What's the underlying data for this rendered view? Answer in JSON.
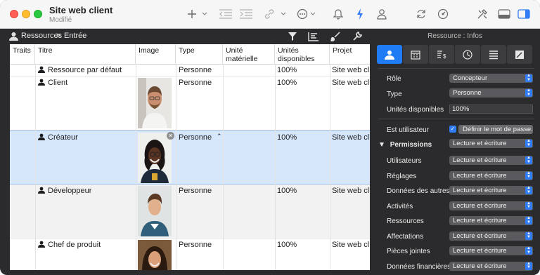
{
  "window": {
    "title": "Site web client",
    "subtitle": "Modifié"
  },
  "toolbar": {
    "icons": [
      "plus-icon",
      "outdent-icon",
      "indent-icon",
      "link-icon",
      "more-icon",
      "bell-icon",
      "flash-icon",
      "person-icon",
      "refresh-icon",
      "dashboard-icon",
      "tools-icon",
      "bottom-panel-icon",
      "side-panel-icon"
    ]
  },
  "breadcrumb": {
    "root": "Ressources",
    "separator": ">",
    "current": "Entrée"
  },
  "table": {
    "columns": [
      "Traits",
      "Titre",
      "Image",
      "Type",
      "Unité matérielle",
      "Unités disponibles",
      "Projet"
    ],
    "rows": [
      {
        "title": "Ressource par défaut",
        "type": "Personne",
        "units": "100%",
        "project": "Site web client",
        "selected": false
      },
      {
        "title": "Client",
        "type": "Personne",
        "units": "100%",
        "project": "Site web client",
        "selected": false
      },
      {
        "title": "Créateur",
        "type": "Personne",
        "units": "100%",
        "project": "Site web client",
        "selected": true
      },
      {
        "title": "Développeur",
        "type": "Personne",
        "units": "100%",
        "project": "Site web client",
        "selected": false
      },
      {
        "title": "Chef de produit",
        "type": "Personne",
        "units": "100%",
        "project": "Site web client",
        "selected": false
      }
    ]
  },
  "inspector": {
    "title": "Ressource : Infos",
    "tabs": [
      "person-tab-icon",
      "calendar-tab-icon",
      "cost-tab-icon",
      "clock-tab-icon",
      "list-tab-icon",
      "notes-tab-icon"
    ],
    "role_label": "Rôle",
    "role_value": "Concepteur",
    "type_label": "Type",
    "type_value": "Personne",
    "units_label": "Unités disponibles",
    "units_value": "100%",
    "user_label": "Est utilisateur",
    "user_checked": true,
    "password_button": "Définir le mot de passe...",
    "permissions_label": "Permissions",
    "permissions_value": "Lecture et écriture",
    "permission_rows": [
      {
        "label": "Utilisateurs",
        "value": "Lecture et écriture"
      },
      {
        "label": "Réglages",
        "value": "Lecture et écriture"
      },
      {
        "label": "Données des autres",
        "value": "Lecture et écriture"
      },
      {
        "label": "Activités",
        "value": "Lecture et écriture"
      },
      {
        "label": "Ressources",
        "value": "Lecture et écriture"
      },
      {
        "label": "Affectations",
        "value": "Lecture et écriture"
      },
      {
        "label": "Pièces jointes",
        "value": "Lecture et écriture"
      },
      {
        "label": "Données financières",
        "value": "Lecture et écriture"
      }
    ]
  },
  "colors": {
    "accent": "#1f7cf4",
    "selection": "#d7e7fb",
    "panel": "#2b2b2d"
  }
}
